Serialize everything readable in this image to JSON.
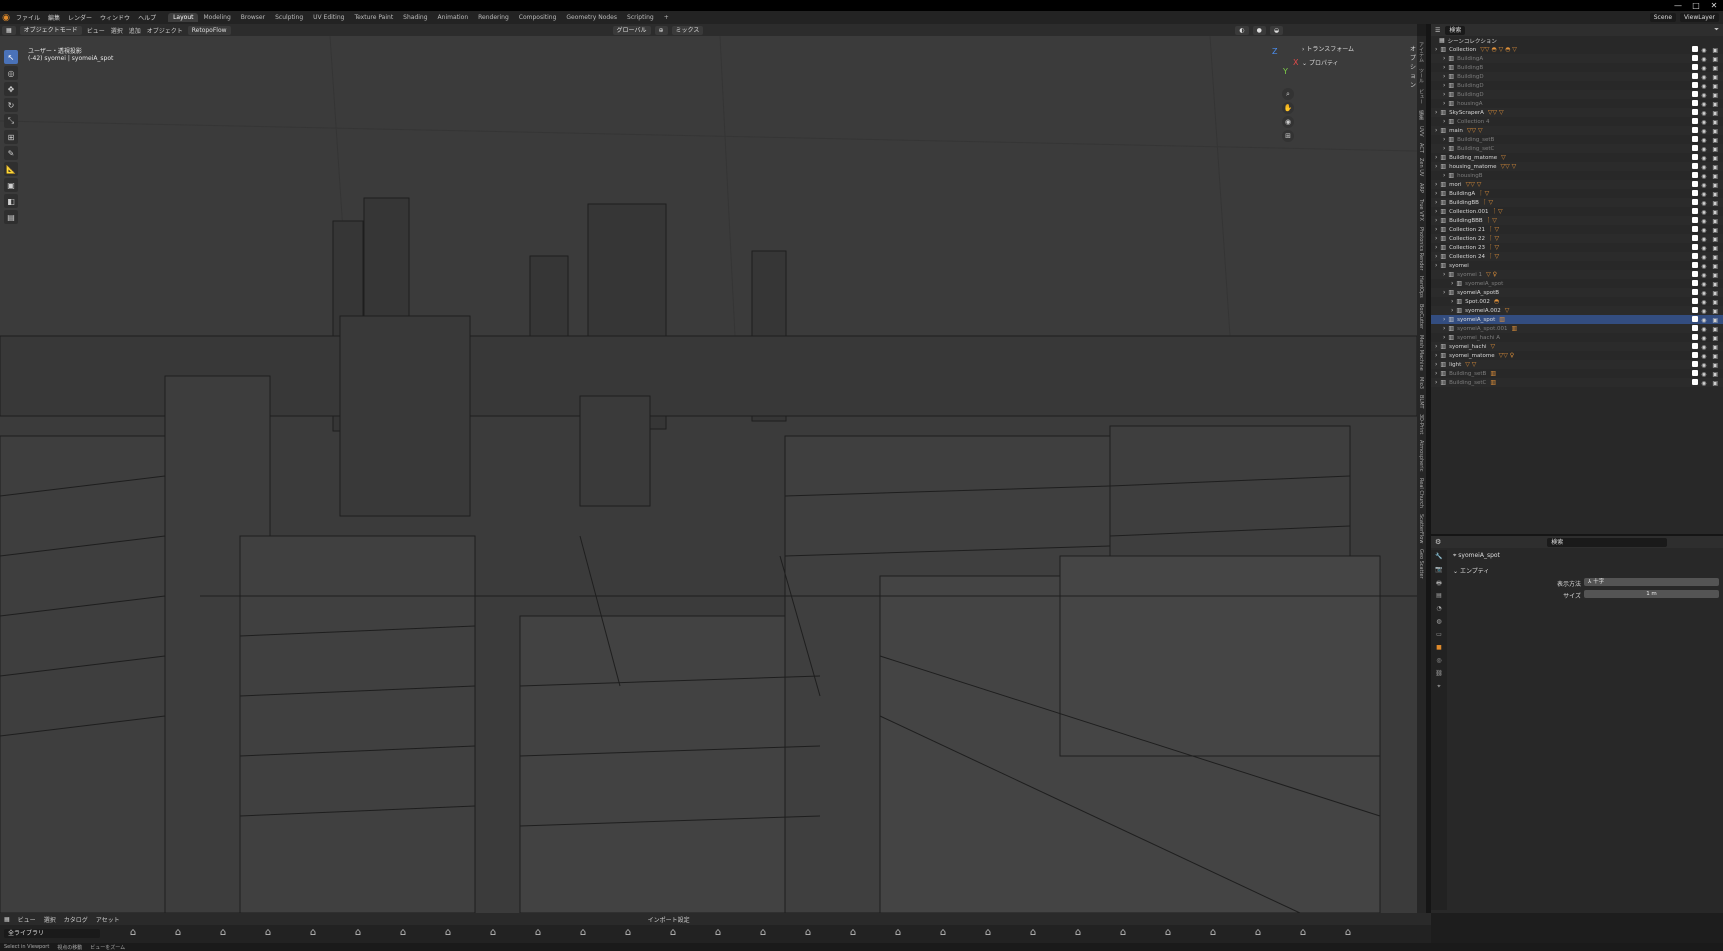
{
  "window": {
    "controls": [
      "—",
      "□",
      "✕"
    ]
  },
  "menu": {
    "items": [
      "ファイル",
      "編集",
      "レンダー",
      "ウィンドウ",
      "ヘルプ"
    ],
    "tabs": [
      "Layout",
      "Modeling",
      "Browser",
      "Sculpting",
      "UV Editing",
      "Texture Paint",
      "Shading",
      "Animation",
      "Rendering",
      "Compositing",
      "Geometry Nodes",
      "Scripting",
      "+"
    ],
    "active_tab": "Layout",
    "scene_label": "Scene",
    "view_layer_label": "ViewLayer"
  },
  "viewport_header": {
    "mode": "オブジェクトモード",
    "items": [
      "ビュー",
      "選択",
      "追加",
      "オブジェクト"
    ],
    "addon": "RetopoFlow",
    "orientation": "グローバル",
    "shading": "ミックス",
    "options": "オプション"
  },
  "viewport": {
    "view_name": "ユーザー・透視投影",
    "object_info": "(-42) syomei | syomeiA_spot",
    "n_panel": [
      "トランスフォーム",
      "プロパティ"
    ],
    "axes": [
      "Z",
      "X",
      "Y"
    ],
    "side_tabs": [
      "アイテム",
      "ツール",
      "ビュー",
      "編集",
      "UVV",
      "ACT",
      "Zen UV",
      "ARP",
      "True VFX",
      "Photonics Render",
      "HardOps",
      "BoxCutter",
      "Mesh Machine",
      "Mio3",
      "BLMT",
      "3D-Print",
      "Atmospheric",
      "Real Church",
      "ScatterFlow",
      "Geo Scatter"
    ]
  },
  "outliner": {
    "title": "シーンコレクション",
    "search_placeholder": "検索",
    "rows": [
      {
        "n": "Collection",
        "d": 0,
        "st": "n",
        "tags": "▽▽ ◓ ▽ ◓ ▽"
      },
      {
        "n": "BuildingA",
        "d": 1,
        "st": "d"
      },
      {
        "n": "BuildingB",
        "d": 1,
        "st": "d"
      },
      {
        "n": "BuildingD",
        "d": 1,
        "st": "d"
      },
      {
        "n": "BuildingD",
        "d": 1,
        "st": "d"
      },
      {
        "n": "BuildingD",
        "d": 1,
        "st": "d"
      },
      {
        "n": "housingA",
        "d": 1,
        "st": "d"
      },
      {
        "n": "SkyScraperA",
        "d": 0,
        "st": "n",
        "tags": "▽▽  ▽"
      },
      {
        "n": "Collection 4",
        "d": 1,
        "st": "d"
      },
      {
        "n": "main",
        "d": 0,
        "st": "n",
        "tags": "▽▽  ▽"
      },
      {
        "n": "Building_setB",
        "d": 1,
        "st": "d"
      },
      {
        "n": "Building_setC",
        "d": 1,
        "st": "d"
      },
      {
        "n": "Building_matome",
        "d": 0,
        "st": "n",
        "tags": "▽"
      },
      {
        "n": "housing_matome",
        "d": 0,
        "st": "n",
        "tags": "▽▽  ▽"
      },
      {
        "n": "housingB",
        "d": 1,
        "st": "d"
      },
      {
        "n": "mori",
        "d": 0,
        "st": "n",
        "tags": "▽▽  ▽"
      },
      {
        "n": "BuildingA",
        "d": 0,
        "st": "n",
        "tags": "ᛙ  ▽"
      },
      {
        "n": "BuildingBB",
        "d": 0,
        "st": "n",
        "tags": "ᛙ  ▽"
      },
      {
        "n": "Collection.001",
        "d": 0,
        "st": "n",
        "tags": "ᛙ  ▽"
      },
      {
        "n": "BuildingBBB",
        "d": 0,
        "st": "n",
        "tags": "ᛙ  ▽"
      },
      {
        "n": "Collection 21",
        "d": 0,
        "st": "n",
        "tags": "ᛙ  ▽"
      },
      {
        "n": "Collection 22",
        "d": 0,
        "st": "n",
        "tags": "ᛙ  ▽"
      },
      {
        "n": "Collection 23",
        "d": 0,
        "st": "n",
        "tags": "ᛙ  ▽"
      },
      {
        "n": "Collection 24",
        "d": 0,
        "st": "n",
        "tags": "ᛙ  ▽"
      },
      {
        "n": "syomei",
        "d": 0,
        "st": "b"
      },
      {
        "n": "syomei 1",
        "d": 1,
        "st": "d",
        "tags": "▽  ♀"
      },
      {
        "n": "syomeiA_spot",
        "d": 2,
        "st": "d"
      },
      {
        "n": "syomeiA_spotB",
        "d": 1,
        "st": "n"
      },
      {
        "n": "Spot.002",
        "d": 2,
        "st": "n",
        "tags": "◓"
      },
      {
        "n": "syomeiA.002",
        "d": 2,
        "st": "n",
        "tags": "▽"
      },
      {
        "n": "syomeiA_spot",
        "d": 1,
        "st": "s",
        "tags": "▥"
      },
      {
        "n": "syomeiA_spot.001",
        "d": 1,
        "st": "d",
        "tags": "▥"
      },
      {
        "n": "syomei_hachi A",
        "d": 1,
        "st": "d"
      },
      {
        "n": "syomei_hachi",
        "d": 0,
        "st": "n",
        "tags": "▽"
      },
      {
        "n": "syomei_matome",
        "d": 0,
        "st": "n",
        "tags": "▽▽  ♀"
      },
      {
        "n": "light",
        "d": 0,
        "st": "n",
        "tags": "▽  ▽"
      },
      {
        "n": "Building_setB",
        "d": 0,
        "st": "d",
        "tags": "▥"
      },
      {
        "n": "Building_setC",
        "d": 0,
        "st": "d",
        "tags": "▥"
      }
    ]
  },
  "properties": {
    "search_placeholder": "検索",
    "object_name": "syomeiA_spot",
    "section": "エンプティ",
    "display_label": "表示方法",
    "display_value": "十字",
    "size_label": "サイズ",
    "size_value": "1 m"
  },
  "asset_bar": {
    "items": [
      "ビュー",
      "選択",
      "カタログ",
      "アセット"
    ],
    "import": "インポート設定",
    "library": "全ライブラリ"
  },
  "status": {
    "items": [
      "Select in Viewport",
      "視点の移動",
      "ビューをズーム"
    ]
  }
}
